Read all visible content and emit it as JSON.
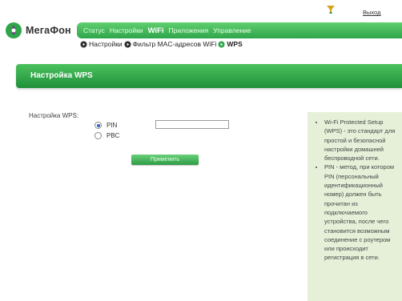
{
  "header": {
    "logout_label": "Выход",
    "brand_name": "МегаФон",
    "status_icon": "signal-funnel-icon"
  },
  "main_nav": {
    "items": [
      {
        "label": "Статус",
        "active": false
      },
      {
        "label": "Настройки",
        "active": false
      },
      {
        "label": "WiFi",
        "active": true
      },
      {
        "label": "Приложения",
        "active": false
      },
      {
        "label": "Управление",
        "active": false
      }
    ]
  },
  "sub_nav": {
    "items": [
      {
        "label": "Настройки",
        "active": false
      },
      {
        "label": "Фильтр MAC-адресов WiFi",
        "active": false
      },
      {
        "label": "WPS",
        "active": true
      }
    ]
  },
  "section": {
    "title": "Настройка WPS"
  },
  "form": {
    "wps_label": "Настройка WPS:",
    "options": [
      {
        "label": "PIN",
        "checked": true
      },
      {
        "label": "PBC",
        "checked": false
      }
    ],
    "pin_value": "",
    "apply_label": "Применить"
  },
  "help": {
    "items": [
      "Wi-Fi Protected Setup (WPS) - это стандарт для простой и безопасной настройки домашней беспроводной сети.",
      "PIN - метод, при котором PIN (персональный идентификационный номер) должен быть прочитан из подключаемого устройства, после чего становится возможным соединение с роутером или происходит регистрация в сети."
    ]
  },
  "colors": {
    "accent_green": "#2fa54a",
    "help_bg": "#e6f0d9",
    "radio_selected": "#2b63c6"
  }
}
